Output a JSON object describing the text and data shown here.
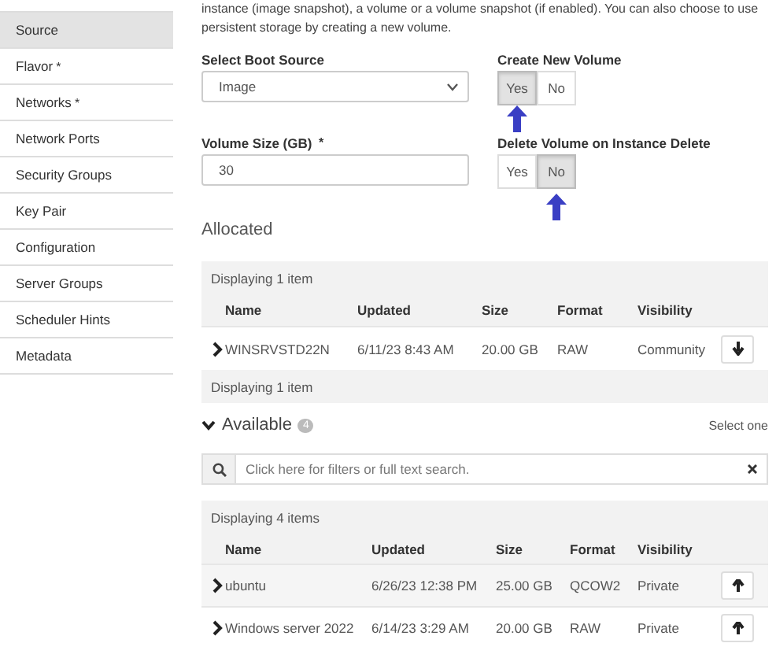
{
  "sidebar": {
    "items": [
      {
        "label": "Source",
        "selected": true
      },
      {
        "label": "Flavor",
        "mark": "*",
        "selected": false
      },
      {
        "label": "Networks",
        "mark": "*",
        "selected": false
      },
      {
        "label": "Network Ports",
        "selected": false
      },
      {
        "label": "Security Groups",
        "selected": false
      },
      {
        "label": "Key Pair",
        "selected": false
      },
      {
        "label": "Configuration",
        "selected": false
      },
      {
        "label": "Server Groups",
        "selected": false
      },
      {
        "label": "Scheduler Hints",
        "selected": false
      },
      {
        "label": "Metadata",
        "selected": false
      }
    ]
  },
  "intro": "instance (image snapshot), a volume or a volume snapshot (if enabled). You can also choose to use persistent storage by creating a new volume.",
  "boot_source": {
    "label": "Select Boot Source",
    "value": "Image"
  },
  "volume_size": {
    "label": "Volume Size (GB)",
    "mark": "*",
    "value": "30"
  },
  "create_new_volume": {
    "label": "Create New Volume",
    "options": [
      {
        "label": "Yes",
        "selected": true
      },
      {
        "label": "No",
        "selected": false
      }
    ]
  },
  "delete_volume": {
    "label": "Delete Volume on Instance Delete",
    "options": [
      {
        "label": "Yes",
        "selected": false
      },
      {
        "label": "No",
        "selected": true
      }
    ]
  },
  "allocated": {
    "title": "Allocated",
    "table": {
      "caption": "Displaying 1 item",
      "columns": [
        "Name",
        "Updated",
        "Size",
        "Format",
        "Visibility"
      ],
      "rows": [
        {
          "cells": [
            "WINSRVSTD22N",
            "6/11/23 8:43 AM",
            "20.00 GB",
            "RAW",
            "Community"
          ],
          "kind": "allocated"
        }
      ],
      "footer": "Displaying 1 item"
    }
  },
  "available": {
    "title": "Available",
    "expanded": true,
    "count": "4",
    "hint": "Select one",
    "search": {
      "placeholder": "Click here for filters or full text search."
    },
    "table": {
      "caption": "Displaying 4 items",
      "columns": [
        "Name",
        "Updated",
        "Size",
        "Format",
        "Visibility"
      ],
      "rows": [
        {
          "cells": [
            "ubuntu",
            "6/26/23 12:38 PM",
            "25.00 GB",
            "QCOW2",
            "Private"
          ],
          "kind": "available"
        },
        {
          "cells": [
            "Windows server 2022",
            "6/14/23 3:29 AM",
            "20.00 GB",
            "RAW",
            "Private"
          ],
          "kind": "available"
        }
      ]
    }
  }
}
